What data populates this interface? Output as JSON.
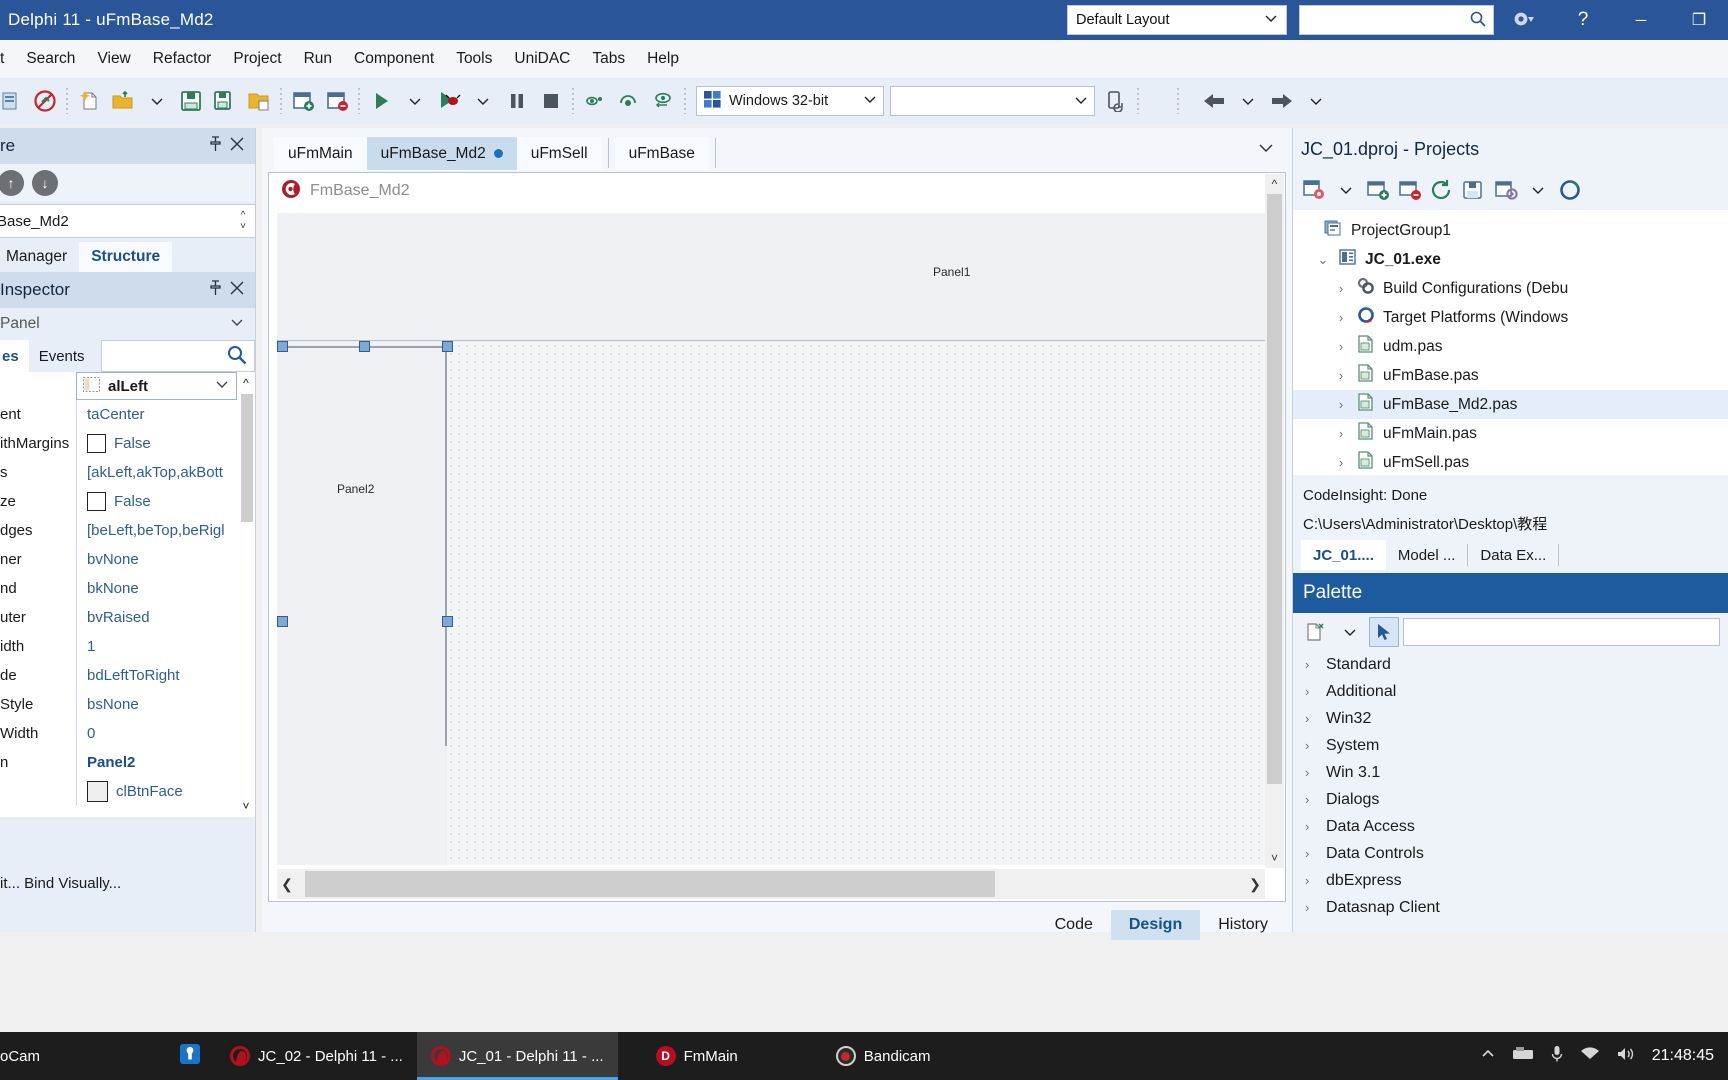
{
  "titlebar": {
    "title": "Delphi 11 - uFmBase_Md2",
    "layout_selector": "Default Layout",
    "search_placeholder": "",
    "gear_icon": "gear-icon",
    "help_label": "?",
    "minimize_label": "─",
    "restore_label": "❐"
  },
  "menubar": {
    "items": [
      "t",
      "Search",
      "View",
      "Refactor",
      "Project",
      "Run",
      "Component",
      "Tools",
      "UniDAC",
      "Tabs",
      "Help"
    ]
  },
  "toolbar": {
    "platform": "Windows 32-bit",
    "config": ""
  },
  "structure_panel": {
    "title": "re",
    "pin_icon": "pin-icon",
    "close_icon": "close-icon",
    "up_icon": "↑",
    "down_icon": "↓",
    "combo_value": "Base_Md2",
    "tabs": [
      {
        "label": "Manager",
        "active": false
      },
      {
        "label": "Structure",
        "active": true
      }
    ]
  },
  "object_inspector": {
    "title": "Inspector",
    "pin_icon": "pin-icon",
    "close_icon": "close-icon",
    "component": "Panel",
    "tabs": [
      {
        "label": "es",
        "active": true
      },
      {
        "label": "Events",
        "active": false
      }
    ],
    "search_value": "",
    "selected_property": {
      "name": "alLeft"
    },
    "rows": [
      {
        "name": "ent",
        "value": "taCenter",
        "type": "text"
      },
      {
        "name": "ithMargins",
        "value": "False",
        "type": "checkbox"
      },
      {
        "name": "s",
        "value": "[akLeft,akTop,akBott",
        "type": "text"
      },
      {
        "name": "ze",
        "value": "False",
        "type": "checkbox"
      },
      {
        "name": "dges",
        "value": "[beLeft,beTop,beRigl",
        "type": "text"
      },
      {
        "name": "ner",
        "value": "bvNone",
        "type": "text"
      },
      {
        "name": "nd",
        "value": "bkNone",
        "type": "text"
      },
      {
        "name": "uter",
        "value": "bvRaised",
        "type": "text"
      },
      {
        "name": "idth",
        "value": "1",
        "type": "text"
      },
      {
        "name": "de",
        "value": "bdLeftToRight",
        "type": "text"
      },
      {
        "name": "Style",
        "value": "bsNone",
        "type": "text"
      },
      {
        "name": "Width",
        "value": "0",
        "type": "text"
      },
      {
        "name": "n",
        "value": "Panel2",
        "type": "bold"
      },
      {
        "name": "",
        "value": "clBtnFace",
        "type": "color"
      }
    ],
    "footer": "it...   Bind Visually..."
  },
  "editor": {
    "tabs": [
      {
        "label": "uFmMain",
        "active": false,
        "modified": false
      },
      {
        "label": "uFmBase_Md2",
        "active": true,
        "modified": true
      },
      {
        "label": "uFmSell",
        "active": false,
        "modified": false
      },
      {
        "label": "uFmBase",
        "active": false,
        "modified": false
      }
    ],
    "form_caption": "FmBase_Md2",
    "panels": [
      {
        "name": "Panel1"
      },
      {
        "name": "Panel2"
      }
    ],
    "view_buttons": [
      {
        "label": "Code",
        "active": false
      },
      {
        "label": "Design",
        "active": true
      },
      {
        "label": "History",
        "active": false
      }
    ]
  },
  "projects_panel": {
    "title": "JC_01.dproj - Projects",
    "tree": [
      {
        "label": "ProjectGroup1",
        "level": 0,
        "expander": "",
        "icon": "project-group-icon",
        "bold": false,
        "selected": false
      },
      {
        "label": "JC_01.exe",
        "level": 1,
        "expander": "⌄",
        "icon": "exe-icon",
        "bold": true,
        "selected": false
      },
      {
        "label": "Build Configurations (Debu",
        "level": 2,
        "expander": "›",
        "icon": "build-config-icon",
        "bold": false,
        "selected": false
      },
      {
        "label": "Target Platforms (Windows",
        "level": 2,
        "expander": "›",
        "icon": "target-platform-icon",
        "bold": false,
        "selected": false
      },
      {
        "label": "udm.pas",
        "level": 2,
        "expander": "›",
        "icon": "pas-file-icon",
        "bold": false,
        "selected": false
      },
      {
        "label": "uFmBase.pas",
        "level": 2,
        "expander": "›",
        "icon": "pas-file-icon",
        "bold": false,
        "selected": false
      },
      {
        "label": "uFmBase_Md2.pas",
        "level": 2,
        "expander": "›",
        "icon": "pas-file-icon",
        "bold": false,
        "selected": true
      },
      {
        "label": "uFmMain.pas",
        "level": 2,
        "expander": "›",
        "icon": "pas-file-icon",
        "bold": false,
        "selected": false
      },
      {
        "label": "uFmSell.pas",
        "level": 2,
        "expander": "›",
        "icon": "pas-file-icon",
        "bold": false,
        "selected": false
      }
    ],
    "status_lines": [
      "CodeInsight: Done",
      "C:\\Users\\Administrator\\Desktop\\教程"
    ],
    "tabs": [
      {
        "label": "JC_01....",
        "active": true
      },
      {
        "label": "Model ...",
        "active": false
      },
      {
        "label": "Data Ex...",
        "active": false
      }
    ]
  },
  "palette": {
    "title": "Palette",
    "search_value": "",
    "categories": [
      "Standard",
      "Additional",
      "Win32",
      "System",
      "Win 3.1",
      "Dialogs",
      "Data Access",
      "Data Controls",
      "dbExpress",
      "Datasnap Client"
    ]
  },
  "taskbar": {
    "apps": [
      {
        "label": "oCam",
        "icon": "ocam-icon",
        "active": false
      },
      {
        "label": "",
        "icon": "tortoise-icon",
        "active": false
      },
      {
        "label": "JC_02 - Delphi 11 - ...",
        "icon": "delphi-icon",
        "active": false
      },
      {
        "label": "JC_01 - Delphi 11 - ...",
        "icon": "delphi-icon",
        "active": true
      },
      {
        "label": "FmMain",
        "icon": "delphi-app-icon",
        "active": false
      },
      {
        "label": "Bandicam",
        "icon": "bandicam-icon",
        "active": false
      }
    ],
    "clock": "21:48:45"
  },
  "colors": {
    "title_bar": "#2a5699",
    "accent": "#1e5b9e",
    "selection": "#7fa8d4",
    "palette_header": "#1e5b9e"
  }
}
